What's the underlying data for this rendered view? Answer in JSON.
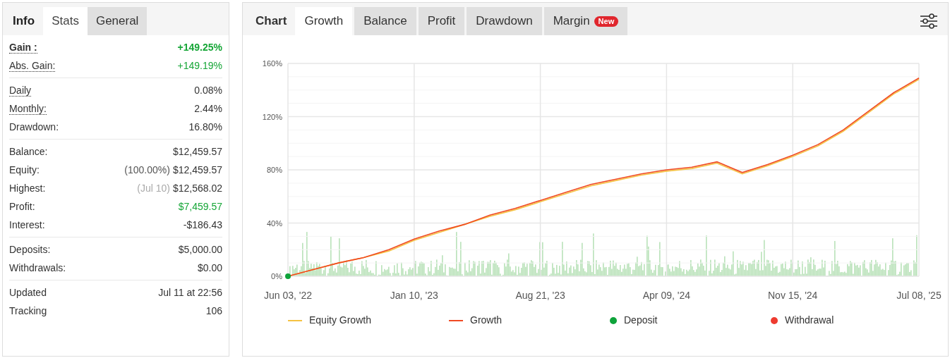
{
  "stats_panel": {
    "tabs": [
      {
        "label": "Info",
        "selected": false,
        "kind": "plain"
      },
      {
        "label": "Stats",
        "selected": true,
        "kind": "box"
      },
      {
        "label": "General",
        "selected": false,
        "kind": "box"
      }
    ],
    "sections": [
      {
        "rows": [
          {
            "label": "Gain :",
            "bold": true,
            "underlined": true,
            "value": "+149.25%",
            "positive": true
          },
          {
            "label": "Abs. Gain:",
            "bold": false,
            "underlined": true,
            "value": "+149.19%",
            "positive": true
          }
        ]
      },
      {
        "rows": [
          {
            "label": "Daily",
            "bold": false,
            "underlined": true,
            "value": "0.08%",
            "positive": false
          },
          {
            "label": "Monthly:",
            "bold": false,
            "underlined": true,
            "value": "2.44%",
            "positive": false
          },
          {
            "label": "Drawdown:",
            "bold": false,
            "underlined": false,
            "value": "16.80%",
            "positive": false
          }
        ]
      },
      {
        "rows": [
          {
            "label": "Balance:",
            "bold": false,
            "underlined": false,
            "value": "$12,459.57",
            "positive": false
          },
          {
            "label": "Equity:",
            "bold": false,
            "underlined": false,
            "note": "(100.00%)",
            "note_muted": false,
            "value": "$12,459.57",
            "positive": false
          },
          {
            "label": "Highest:",
            "bold": false,
            "underlined": false,
            "note": "(Jul 10)",
            "note_muted": true,
            "value": "$12,568.02",
            "positive": false
          },
          {
            "label": "Profit:",
            "bold": false,
            "underlined": false,
            "value": "$7,459.57",
            "positive": true
          },
          {
            "label": "Interest:",
            "bold": false,
            "underlined": false,
            "value": "-$186.43",
            "positive": false
          }
        ]
      },
      {
        "rows": [
          {
            "label": "Deposits:",
            "bold": false,
            "underlined": false,
            "value": "$5,000.00",
            "positive": false
          },
          {
            "label": "Withdrawals:",
            "bold": false,
            "underlined": false,
            "value": "$0.00",
            "positive": false
          }
        ]
      },
      {
        "rows": [
          {
            "label": "Updated",
            "bold": false,
            "underlined": false,
            "value": "Jul 11 at 22:56",
            "positive": false
          },
          {
            "label": "Tracking",
            "bold": false,
            "underlined": false,
            "value": "106",
            "positive": false
          }
        ]
      }
    ]
  },
  "chart_panel": {
    "title": "Chart",
    "tabs": [
      {
        "label": "Growth",
        "selected": true
      },
      {
        "label": "Balance",
        "selected": false
      },
      {
        "label": "Profit",
        "selected": false
      },
      {
        "label": "Drawdown",
        "selected": false
      },
      {
        "label": "Margin",
        "selected": false,
        "badge": "New"
      }
    ],
    "chart_data": {
      "type": "line",
      "grid": true,
      "categories": [
        "Jun 03, '22",
        null,
        null,
        null,
        null,
        "Jan 10, '23",
        null,
        null,
        null,
        null,
        "Aug 21, '23",
        null,
        null,
        null,
        null,
        "Apr 09, '24",
        null,
        null,
        null,
        null,
        "Nov 15, '24",
        null,
        null,
        null,
        null,
        "Jul 08, '25"
      ],
      "ylim": [
        0,
        160
      ],
      "yticks": [
        {
          "value": 0,
          "label": "0%"
        },
        {
          "value": 40,
          "label": "40%"
        },
        {
          "value": 80,
          "label": "80%"
        },
        {
          "value": 120,
          "label": "120%"
        },
        {
          "value": 160,
          "label": "160%"
        }
      ],
      "series": [
        {
          "name": "Equity Growth",
          "color": "#f5c242",
          "values": [
            0,
            5,
            10,
            14,
            19,
            27,
            33,
            39,
            45,
            50,
            56,
            62,
            68,
            72,
            76,
            79,
            81,
            85,
            77,
            83,
            90,
            98,
            109,
            123,
            137,
            148
          ]
        },
        {
          "name": "Growth",
          "color": "#f04a23",
          "values": [
            0,
            5,
            10,
            14,
            20,
            28,
            34,
            39,
            46,
            51,
            57,
            63,
            69,
            73,
            77,
            80,
            82,
            86,
            78,
            84,
            91,
            99,
            110,
            124,
            138,
            149
          ]
        }
      ]
    },
    "markers": [
      {
        "label": "Deposit",
        "kind": "dot",
        "color": "#0ea33a"
      },
      {
        "label": "Withdrawal",
        "kind": "dot",
        "color": "#ee3b30"
      }
    ]
  }
}
